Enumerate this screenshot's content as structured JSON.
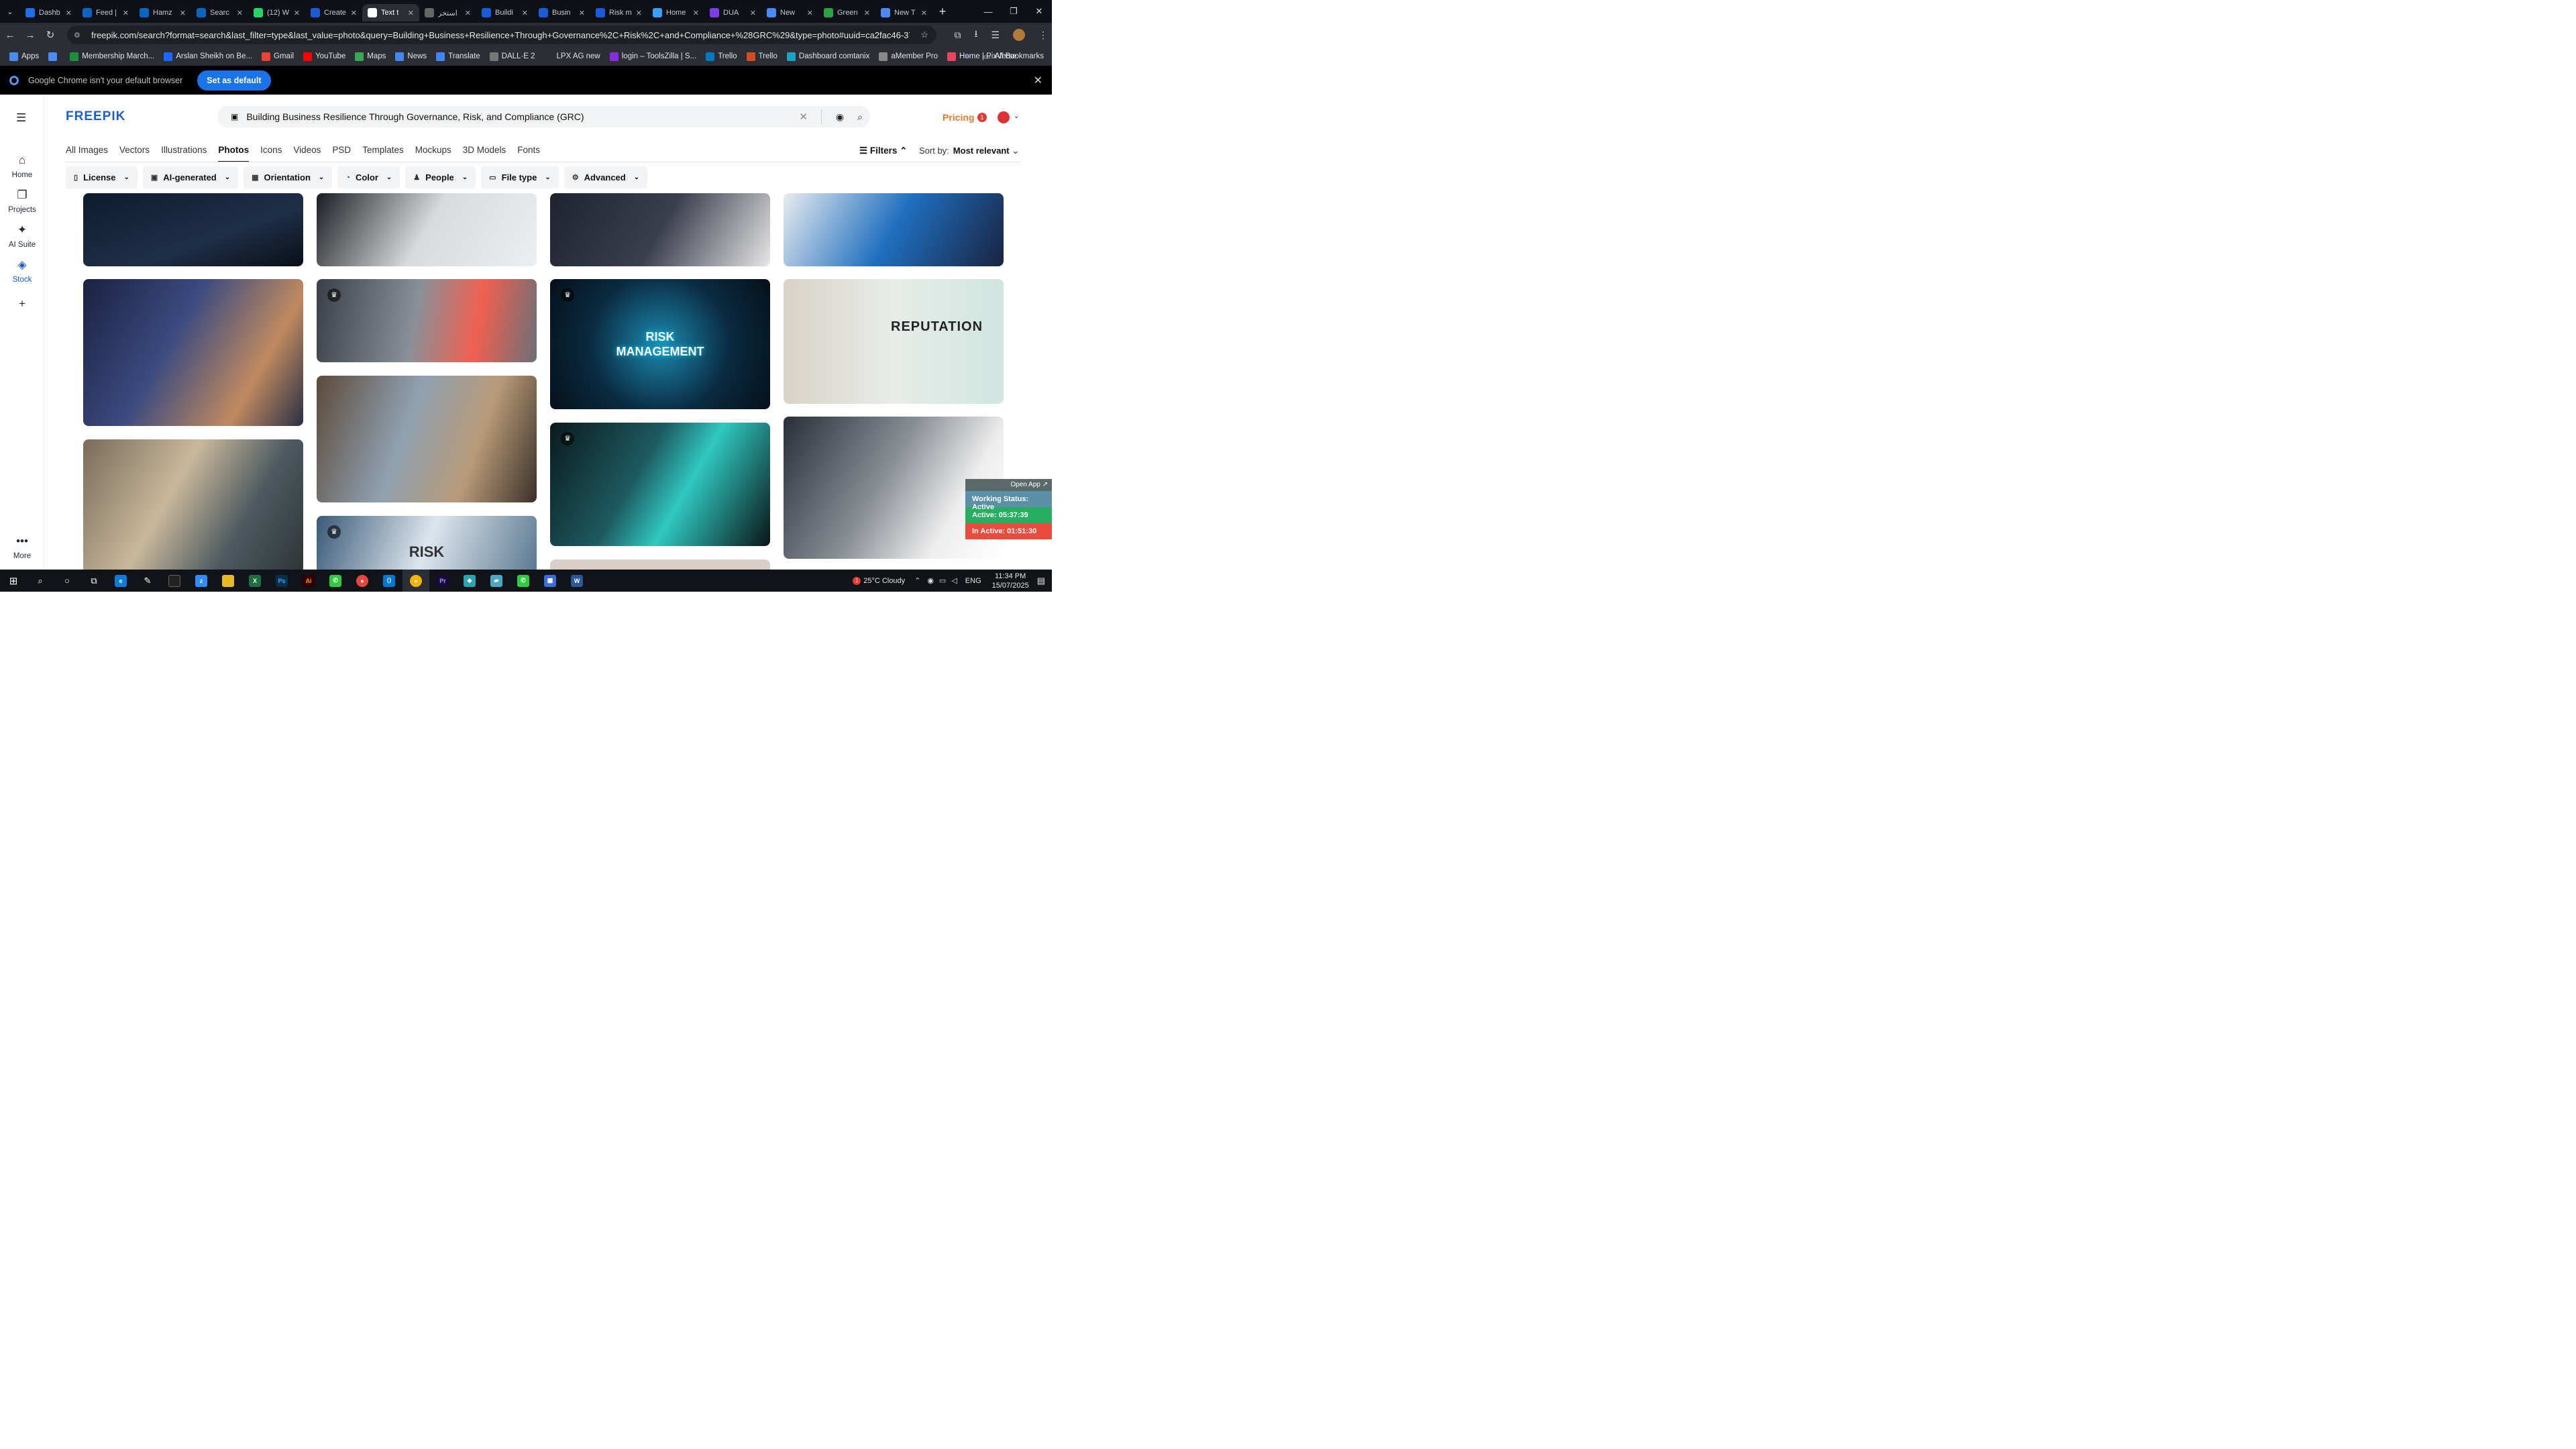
{
  "tabs": [
    {
      "title": "Dashb",
      "color": "#1f6feb"
    },
    {
      "title": "Feed |",
      "color": "#0a66c2"
    },
    {
      "title": "Hamz",
      "color": "#0a66c2"
    },
    {
      "title": "Searc",
      "color": "#0a66c2"
    },
    {
      "title": "(12) W",
      "color": "#25d366"
    },
    {
      "title": "Create",
      "color": "#1a5bd8"
    },
    {
      "title": "Text t",
      "color": "#ffffff"
    },
    {
      "title": "استخر",
      "color": "#666666"
    },
    {
      "title": "Buildi",
      "color": "#1a5bd8"
    },
    {
      "title": "Busin",
      "color": "#1a5bd8"
    },
    {
      "title": "Risk m",
      "color": "#1a5bd8"
    },
    {
      "title": "Home",
      "color": "#3aa0ff"
    },
    {
      "title": "DUA",
      "color": "#7b3fe4"
    },
    {
      "title": "New",
      "color": "#4a8af4"
    },
    {
      "title": "Green",
      "color": "#2ea043"
    },
    {
      "title": "New T",
      "color": "#4a8af4"
    }
  ],
  "browser": {
    "url": "freepik.com/search?format=search&last_filter=type&last_value=photo&query=Building+Business+Resilience+Through+Governance%2C+Risk%2C+and+Compliance+%28GRC%29&type=photo#uuid=ca2fac46-376d-4ca8-8abf-f91f3712acd7",
    "bookmarks": [
      {
        "label": "Apps",
        "color": "#4a8af4"
      },
      {
        "label": "",
        "color": "#4a8af4"
      },
      {
        "label": "Membership March...",
        "color": "#1e8e3e"
      },
      {
        "label": "Arslan Sheikh on Be...",
        "color": "#1769ff"
      },
      {
        "label": "Gmail",
        "color": "#ea4335"
      },
      {
        "label": "YouTube",
        "color": "#ff0000"
      },
      {
        "label": "Maps",
        "color": "#34a853"
      },
      {
        "label": "News",
        "color": "#4285f4"
      },
      {
        "label": "Translate",
        "color": "#4285f4"
      },
      {
        "label": "DALL·E 2",
        "color": "#777777"
      },
      {
        "label": "LPX AG new",
        "color": "#2b2e35"
      },
      {
        "label": "login – ToolsZilla | S...",
        "color": "#8a2be2"
      },
      {
        "label": "Trello",
        "color": "#0079bf"
      },
      {
        "label": "Trello",
        "color": "#d24d1f"
      },
      {
        "label": "Dashboard comtanix",
        "color": "#1aa3c8"
      },
      {
        "label": "aMember Pro",
        "color": "#888888"
      },
      {
        "label": "Home | PixVerse",
        "color": "#e94560"
      }
    ],
    "all_bookmarks": "All Bookmarks",
    "info_message": "Google Chrome isn't your default browser",
    "info_button": "Set as default"
  },
  "sidebar": [
    {
      "label": "Home",
      "icon": "⌂"
    },
    {
      "label": "Projects",
      "icon": "❐"
    },
    {
      "label": "AI Suite",
      "icon": "✦"
    },
    {
      "label": "Stock",
      "icon": "◈"
    },
    {
      "label": "",
      "icon": "+"
    },
    {
      "label": "More",
      "icon": "•••"
    }
  ],
  "header": {
    "logo": "FREEPIK",
    "search_query": "Building Business Resilience Through Governance, Risk, and Compliance (GRC)",
    "pricing": "Pricing",
    "notif_count": "1"
  },
  "categories": [
    "All Images",
    "Vectors",
    "Illustrations",
    "Photos",
    "Icons",
    "Videos",
    "PSD",
    "Templates",
    "Mockups",
    "3D Models",
    "Fonts"
  ],
  "filters_label": "Filters",
  "sort": {
    "label": "Sort by:",
    "value": "Most relevant"
  },
  "filter_chips": [
    {
      "label": "License",
      "icon": "▯"
    },
    {
      "label": "AI-generated",
      "icon": "▣"
    },
    {
      "label": "Orientation",
      "icon": "▦"
    },
    {
      "label": "Color",
      "icon": "◔"
    },
    {
      "label": "People",
      "icon": "♟"
    },
    {
      "label": "File type",
      "icon": "▭"
    },
    {
      "label": "Advanced",
      "icon": "⚙"
    }
  ],
  "image_captions": {
    "risk_management": "RISK\nMANAGEMENT",
    "reputation": "REPUTATION",
    "risk": "RISK"
  },
  "tracker": {
    "open_app": "Open App ↗",
    "status": "Working Status: Active",
    "active": "Active: 05:37:39",
    "inactive": "In Active: 01:51:30"
  },
  "taskbar": {
    "weather": "25°C  Cloudy",
    "lang": "ENG",
    "time": "11:34 PM",
    "date": "15/07/2025",
    "notif": "1"
  }
}
